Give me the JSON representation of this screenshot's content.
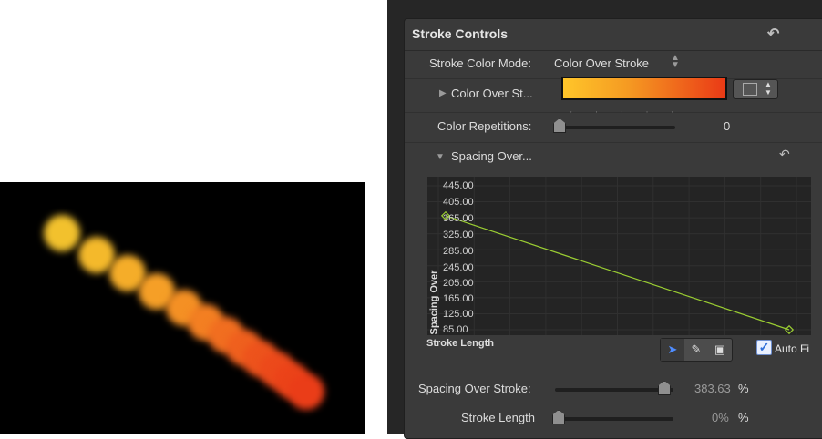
{
  "panel": {
    "title": "Stroke Controls",
    "reset_icon": "reset-arrow-icon",
    "stroke_color_mode": {
      "label": "Stroke Color Mode:",
      "value": "Color Over Stroke"
    },
    "color_over_stroke": {
      "label": "Color Over St...",
      "gradient_colors": [
        "#ffc62a",
        "#f59a22",
        "#ea3a16"
      ]
    },
    "color_repetitions": {
      "label": "Color Repetitions:",
      "value": "0"
    },
    "spacing_over": {
      "label": "Spacing Over..."
    },
    "graph": {
      "y_ticks": [
        "445.00",
        "405.00",
        "365.00",
        "325.00",
        "285.00",
        "245.00",
        "205.00",
        "165.00",
        "125.00",
        "85.00"
      ],
      "y_axis_label": "Spacing Over",
      "x_axis_label": "Stroke Length",
      "curve_color": "#9acd32",
      "points": [
        {
          "x": 0,
          "y": 370
        },
        {
          "x": 100,
          "y": 85
        }
      ]
    },
    "tools": [
      "select-arrow-icon",
      "pencil-icon",
      "frame-icon"
    ],
    "auto_fit_label": "Auto Fi",
    "spacing_over_stroke": {
      "label": "Spacing Over Stroke:",
      "value": "383.63",
      "unit": "%"
    },
    "stroke_length": {
      "label": "Stroke Length",
      "value": "0%",
      "unit": "%"
    }
  }
}
